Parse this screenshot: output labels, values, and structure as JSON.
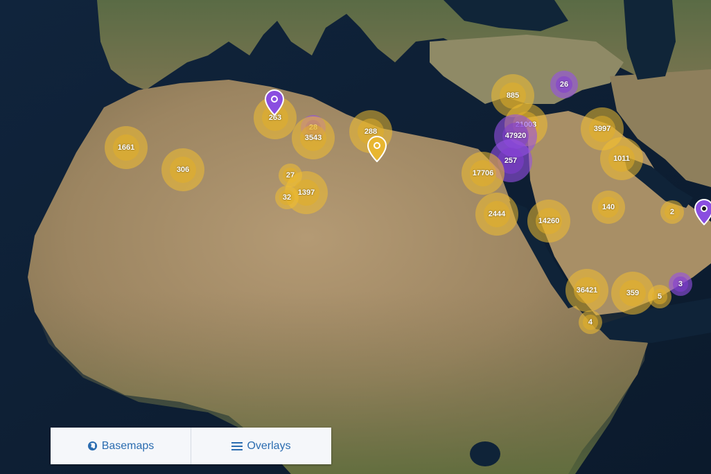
{
  "map": {
    "basemap": "satellite-imagery"
  },
  "clusters": [
    {
      "label": "1661",
      "color": "gold"
    },
    {
      "label": "306",
      "color": "gold"
    },
    {
      "label": "263",
      "color": "gold"
    },
    {
      "label": "28",
      "color": "purple"
    },
    {
      "label": "3543",
      "color": "gold"
    },
    {
      "label": "27",
      "color": "gold"
    },
    {
      "label": "1397",
      "color": "gold"
    },
    {
      "label": "32",
      "color": "gold"
    },
    {
      "label": "288",
      "color": "gold"
    },
    {
      "label": "885",
      "color": "gold"
    },
    {
      "label": "26",
      "color": "purple"
    },
    {
      "label": "21003",
      "color": "gold"
    },
    {
      "label": "47920",
      "color": "purple"
    },
    {
      "label": "257",
      "color": "purple"
    },
    {
      "label": "17706",
      "color": "gold"
    },
    {
      "label": "3997",
      "color": "gold"
    },
    {
      "label": "1011",
      "color": "gold"
    },
    {
      "label": "140",
      "color": "gold"
    },
    {
      "label": "2",
      "color": "gold"
    },
    {
      "label": "2444",
      "color": "gold"
    },
    {
      "label": "14260",
      "color": "gold"
    },
    {
      "label": "36421",
      "color": "gold"
    },
    {
      "label": "359",
      "color": "gold"
    },
    {
      "label": "5",
      "color": "gold"
    },
    {
      "label": "3",
      "color": "purple"
    },
    {
      "label": "4",
      "color": "gold"
    }
  ],
  "pins": [
    {
      "color": "purple",
      "name": "pin-purple-algeria"
    },
    {
      "color": "gold",
      "name": "pin-gold-libya"
    },
    {
      "color": "purple",
      "name": "pin-purple-gulf"
    }
  ],
  "controls": {
    "basemaps_label": "Basemaps",
    "overlays_label": "Overlays",
    "basemaps_icon": "globe-icon",
    "overlays_icon": "list-icon"
  },
  "colors": {
    "cluster_gold": "#e8b630",
    "cluster_purple": "#8a4ee0",
    "button_text": "#2a6cb0"
  }
}
